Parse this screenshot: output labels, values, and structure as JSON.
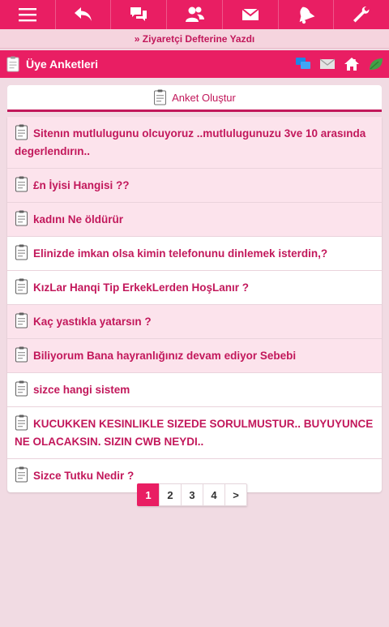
{
  "topnav": {
    "icons": [
      "menu-icon",
      "back-icon",
      "chat-icon",
      "users-icon",
      "mail-icon",
      "bell-icon",
      "wrench-icon"
    ]
  },
  "notice": {
    "text": "» Ziyaretçi Defterine Yazdı"
  },
  "header": {
    "title": "Üye Anketleri",
    "icons": [
      "chat-bubbles-icon",
      "mail-icon",
      "home-icon",
      "leaf-icon"
    ]
  },
  "create": {
    "label": "Anket Oluştur"
  },
  "polls": [
    {
      "title": "Sitenın mutlulugunu olcuyoruz ..mutlulugunuzu 3ve 10 arasında degerlendırın..",
      "highlight": true
    },
    {
      "title": "£n İyisi Hangisi ??",
      "highlight": true
    },
    {
      "title": "kadını Ne öldürür",
      "highlight": true
    },
    {
      "title": "Elinizde imkan olsa kimin telefonunu dinlemek isterdin,?",
      "highlight": false
    },
    {
      "title": "KızLar Hanqi Tip ErkekLerden HoşLanır ?",
      "highlight": false
    },
    {
      "title": "Kaç yastıkla yatarsın ?",
      "highlight": true
    },
    {
      "title": "Biliyorum Bana hayranlığınız devam ediyor Sebebi",
      "highlight": true
    },
    {
      "title": "sizce hangi sistem",
      "highlight": false
    },
    {
      "title": "KUCUKKEN KESINLIKLE SIZEDE SORULMUSTUR.. BUYUYUNCE NE OLACAKSIN. SIZIN CWB NEYDI..",
      "highlight": false
    },
    {
      "title": "Sizce Tutku Nedir ?",
      "highlight": false
    }
  ],
  "pagination": {
    "pages": [
      "1",
      "2",
      "3",
      "4"
    ],
    "current": "1",
    "next": ">"
  }
}
